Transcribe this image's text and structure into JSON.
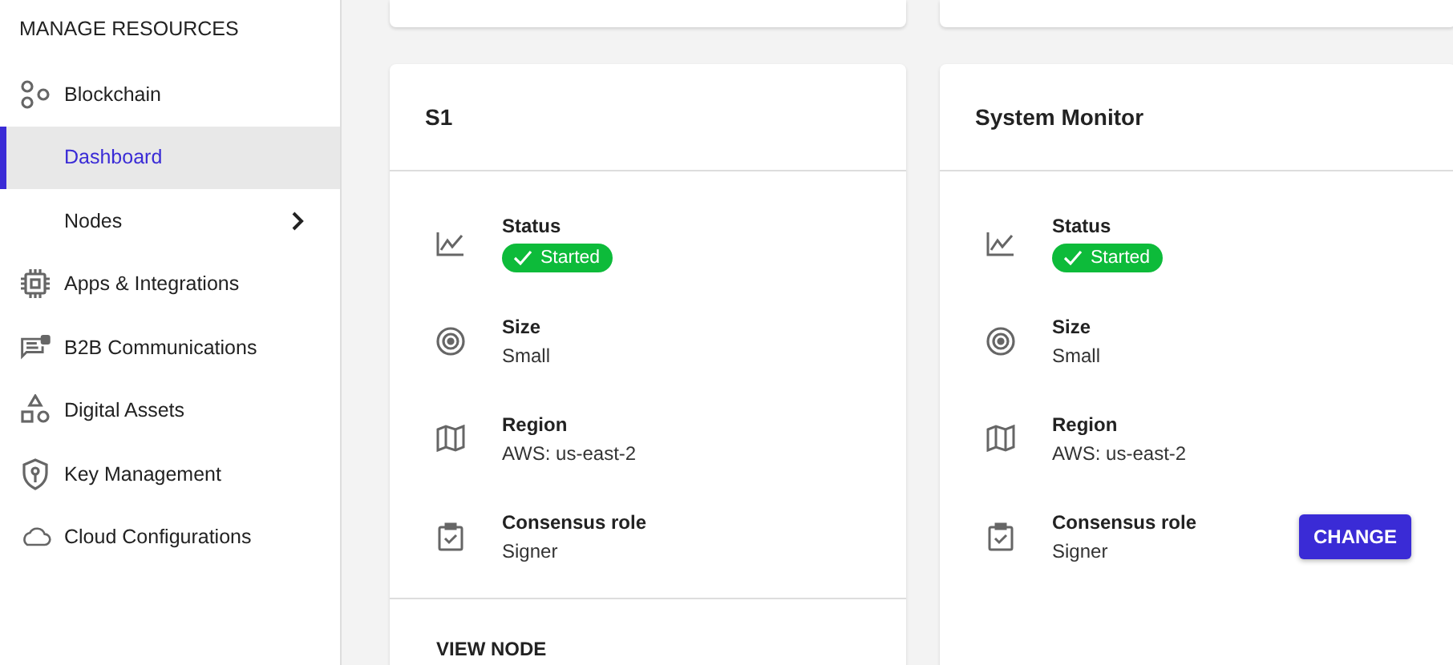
{
  "sidebar": {
    "heading": "MANAGE RESOURCES",
    "items": [
      {
        "label": "Blockchain",
        "kind": "link",
        "selected": false
      },
      {
        "label": "Dashboard",
        "kind": "link",
        "selected": true
      },
      {
        "label": "Nodes",
        "kind": "group",
        "selected": false,
        "expanded": false
      },
      {
        "label": "Apps & Integrations",
        "kind": "link",
        "selected": false
      },
      {
        "label": "B2B Communications",
        "kind": "link",
        "selected": false
      },
      {
        "label": "Digital Assets",
        "kind": "link",
        "selected": false
      },
      {
        "label": "Key Management",
        "kind": "link",
        "selected": false
      },
      {
        "label": "Cloud Configurations",
        "kind": "link",
        "selected": false
      }
    ]
  },
  "cards": [
    {
      "title": "S1",
      "fields": [
        {
          "label": "Status",
          "kind": "badge",
          "value": "Started"
        },
        {
          "label": "Size",
          "kind": "text",
          "value": "Small"
        },
        {
          "label": "Region",
          "kind": "text",
          "value": "AWS: us-east-2"
        },
        {
          "label": "Consensus role",
          "kind": "text",
          "value": "Signer"
        }
      ],
      "footer_action": "VIEW NODE"
    },
    {
      "title": "System Monitor",
      "fields": [
        {
          "label": "Status",
          "kind": "badge",
          "value": "Started"
        },
        {
          "label": "Size",
          "kind": "text",
          "value": "Small"
        },
        {
          "label": "Region",
          "kind": "text",
          "value": "AWS: us-east-2"
        },
        {
          "label": "Consensus role",
          "kind": "text",
          "value": "Signer",
          "action": "CHANGE"
        }
      ]
    }
  ]
}
